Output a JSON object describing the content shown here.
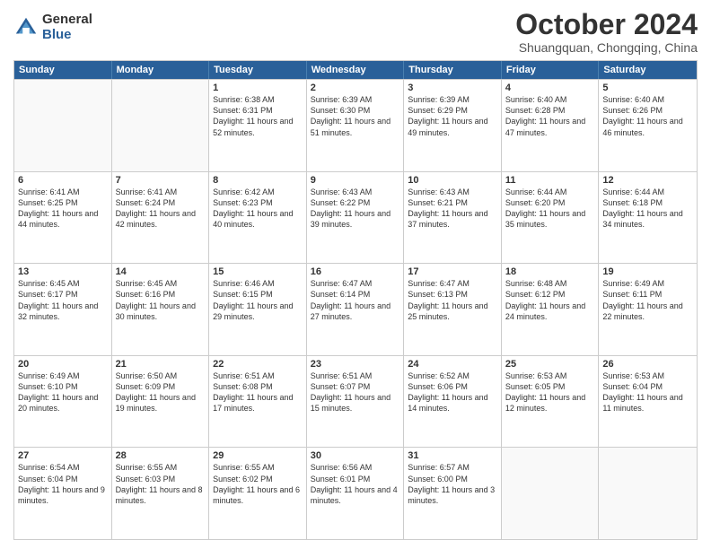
{
  "header": {
    "logo_general": "General",
    "logo_blue": "Blue",
    "month_title": "October 2024",
    "subtitle": "Shuangquan, Chongqing, China"
  },
  "weekdays": [
    "Sunday",
    "Monday",
    "Tuesday",
    "Wednesday",
    "Thursday",
    "Friday",
    "Saturday"
  ],
  "rows": [
    [
      {
        "day": "",
        "sunrise": "",
        "sunset": "",
        "daylight": ""
      },
      {
        "day": "",
        "sunrise": "",
        "sunset": "",
        "daylight": ""
      },
      {
        "day": "1",
        "sunrise": "Sunrise: 6:38 AM",
        "sunset": "Sunset: 6:31 PM",
        "daylight": "Daylight: 11 hours and 52 minutes."
      },
      {
        "day": "2",
        "sunrise": "Sunrise: 6:39 AM",
        "sunset": "Sunset: 6:30 PM",
        "daylight": "Daylight: 11 hours and 51 minutes."
      },
      {
        "day": "3",
        "sunrise": "Sunrise: 6:39 AM",
        "sunset": "Sunset: 6:29 PM",
        "daylight": "Daylight: 11 hours and 49 minutes."
      },
      {
        "day": "4",
        "sunrise": "Sunrise: 6:40 AM",
        "sunset": "Sunset: 6:28 PM",
        "daylight": "Daylight: 11 hours and 47 minutes."
      },
      {
        "day": "5",
        "sunrise": "Sunrise: 6:40 AM",
        "sunset": "Sunset: 6:26 PM",
        "daylight": "Daylight: 11 hours and 46 minutes."
      }
    ],
    [
      {
        "day": "6",
        "sunrise": "Sunrise: 6:41 AM",
        "sunset": "Sunset: 6:25 PM",
        "daylight": "Daylight: 11 hours and 44 minutes."
      },
      {
        "day": "7",
        "sunrise": "Sunrise: 6:41 AM",
        "sunset": "Sunset: 6:24 PM",
        "daylight": "Daylight: 11 hours and 42 minutes."
      },
      {
        "day": "8",
        "sunrise": "Sunrise: 6:42 AM",
        "sunset": "Sunset: 6:23 PM",
        "daylight": "Daylight: 11 hours and 40 minutes."
      },
      {
        "day": "9",
        "sunrise": "Sunrise: 6:43 AM",
        "sunset": "Sunset: 6:22 PM",
        "daylight": "Daylight: 11 hours and 39 minutes."
      },
      {
        "day": "10",
        "sunrise": "Sunrise: 6:43 AM",
        "sunset": "Sunset: 6:21 PM",
        "daylight": "Daylight: 11 hours and 37 minutes."
      },
      {
        "day": "11",
        "sunrise": "Sunrise: 6:44 AM",
        "sunset": "Sunset: 6:20 PM",
        "daylight": "Daylight: 11 hours and 35 minutes."
      },
      {
        "day": "12",
        "sunrise": "Sunrise: 6:44 AM",
        "sunset": "Sunset: 6:18 PM",
        "daylight": "Daylight: 11 hours and 34 minutes."
      }
    ],
    [
      {
        "day": "13",
        "sunrise": "Sunrise: 6:45 AM",
        "sunset": "Sunset: 6:17 PM",
        "daylight": "Daylight: 11 hours and 32 minutes."
      },
      {
        "day": "14",
        "sunrise": "Sunrise: 6:45 AM",
        "sunset": "Sunset: 6:16 PM",
        "daylight": "Daylight: 11 hours and 30 minutes."
      },
      {
        "day": "15",
        "sunrise": "Sunrise: 6:46 AM",
        "sunset": "Sunset: 6:15 PM",
        "daylight": "Daylight: 11 hours and 29 minutes."
      },
      {
        "day": "16",
        "sunrise": "Sunrise: 6:47 AM",
        "sunset": "Sunset: 6:14 PM",
        "daylight": "Daylight: 11 hours and 27 minutes."
      },
      {
        "day": "17",
        "sunrise": "Sunrise: 6:47 AM",
        "sunset": "Sunset: 6:13 PM",
        "daylight": "Daylight: 11 hours and 25 minutes."
      },
      {
        "day": "18",
        "sunrise": "Sunrise: 6:48 AM",
        "sunset": "Sunset: 6:12 PM",
        "daylight": "Daylight: 11 hours and 24 minutes."
      },
      {
        "day": "19",
        "sunrise": "Sunrise: 6:49 AM",
        "sunset": "Sunset: 6:11 PM",
        "daylight": "Daylight: 11 hours and 22 minutes."
      }
    ],
    [
      {
        "day": "20",
        "sunrise": "Sunrise: 6:49 AM",
        "sunset": "Sunset: 6:10 PM",
        "daylight": "Daylight: 11 hours and 20 minutes."
      },
      {
        "day": "21",
        "sunrise": "Sunrise: 6:50 AM",
        "sunset": "Sunset: 6:09 PM",
        "daylight": "Daylight: 11 hours and 19 minutes."
      },
      {
        "day": "22",
        "sunrise": "Sunrise: 6:51 AM",
        "sunset": "Sunset: 6:08 PM",
        "daylight": "Daylight: 11 hours and 17 minutes."
      },
      {
        "day": "23",
        "sunrise": "Sunrise: 6:51 AM",
        "sunset": "Sunset: 6:07 PM",
        "daylight": "Daylight: 11 hours and 15 minutes."
      },
      {
        "day": "24",
        "sunrise": "Sunrise: 6:52 AM",
        "sunset": "Sunset: 6:06 PM",
        "daylight": "Daylight: 11 hours and 14 minutes."
      },
      {
        "day": "25",
        "sunrise": "Sunrise: 6:53 AM",
        "sunset": "Sunset: 6:05 PM",
        "daylight": "Daylight: 11 hours and 12 minutes."
      },
      {
        "day": "26",
        "sunrise": "Sunrise: 6:53 AM",
        "sunset": "Sunset: 6:04 PM",
        "daylight": "Daylight: 11 hours and 11 minutes."
      }
    ],
    [
      {
        "day": "27",
        "sunrise": "Sunrise: 6:54 AM",
        "sunset": "Sunset: 6:04 PM",
        "daylight": "Daylight: 11 hours and 9 minutes."
      },
      {
        "day": "28",
        "sunrise": "Sunrise: 6:55 AM",
        "sunset": "Sunset: 6:03 PM",
        "daylight": "Daylight: 11 hours and 8 minutes."
      },
      {
        "day": "29",
        "sunrise": "Sunrise: 6:55 AM",
        "sunset": "Sunset: 6:02 PM",
        "daylight": "Daylight: 11 hours and 6 minutes."
      },
      {
        "day": "30",
        "sunrise": "Sunrise: 6:56 AM",
        "sunset": "Sunset: 6:01 PM",
        "daylight": "Daylight: 11 hours and 4 minutes."
      },
      {
        "day": "31",
        "sunrise": "Sunrise: 6:57 AM",
        "sunset": "Sunset: 6:00 PM",
        "daylight": "Daylight: 11 hours and 3 minutes."
      },
      {
        "day": "",
        "sunrise": "",
        "sunset": "",
        "daylight": ""
      },
      {
        "day": "",
        "sunrise": "",
        "sunset": "",
        "daylight": ""
      }
    ]
  ]
}
